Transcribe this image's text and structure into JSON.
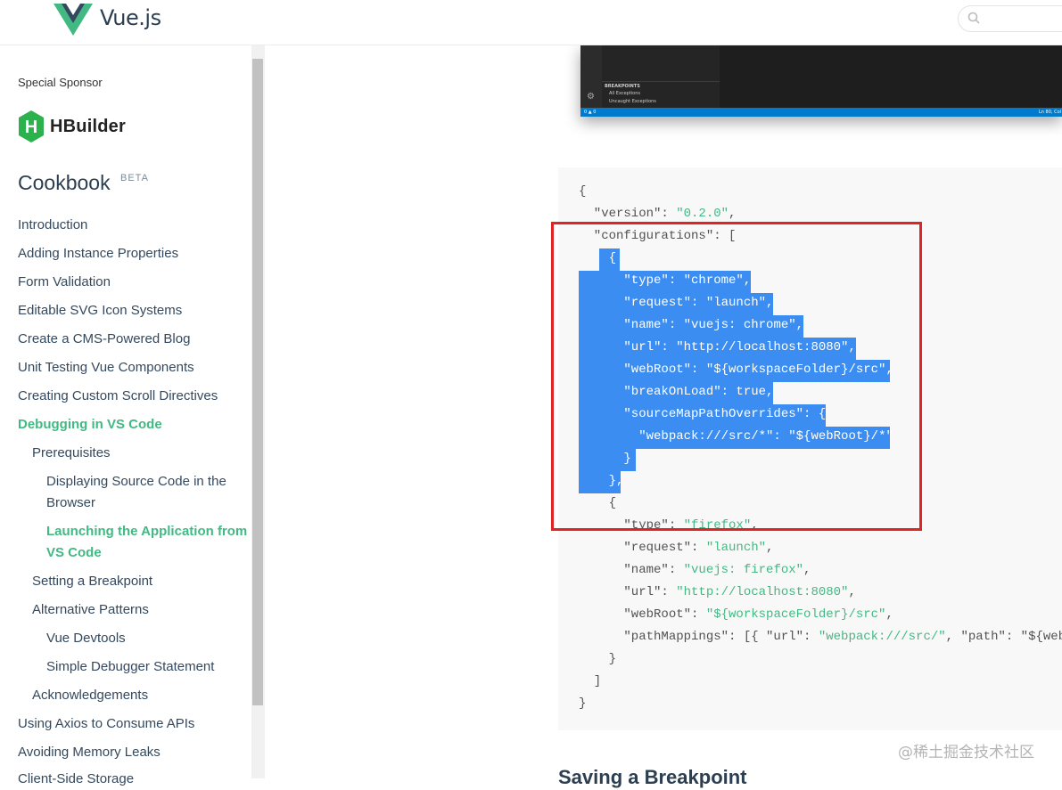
{
  "header": {
    "brand": "Vue.js",
    "search": {
      "placeholder": ""
    }
  },
  "sidebar": {
    "sponsor_label": "Special Sponsor",
    "sponsor_name": "HBuilder",
    "sponsor_logo_letter": "H",
    "title": "Cookbook",
    "badge": "BETA",
    "items": [
      {
        "label": "Introduction"
      },
      {
        "label": "Adding Instance Properties"
      },
      {
        "label": "Form Validation"
      },
      {
        "label": "Editable SVG Icon Systems"
      },
      {
        "label": "Create a CMS-Powered Blog"
      },
      {
        "label": "Unit Testing Vue Components"
      },
      {
        "label": "Creating Custom Scroll Directives"
      },
      {
        "label": "Debugging in VS Code"
      },
      {
        "label": "Prerequisites"
      },
      {
        "label": "Displaying Source Code in the"
      },
      {
        "label": "Browser"
      },
      {
        "label": "Launching the Application from"
      },
      {
        "label": "VS Code"
      },
      {
        "label": "Setting a Breakpoint"
      },
      {
        "label": "Alternative Patterns"
      },
      {
        "label": "Vue Devtools"
      },
      {
        "label": "Simple Debugger Statement"
      },
      {
        "label": "Acknowledgements"
      },
      {
        "label": "Using Axios to Consume APIs"
      },
      {
        "label": "Avoiding Memory Leaks"
      },
      {
        "label": "Client-Side Storage"
      }
    ]
  },
  "embedded_screenshot": {
    "breakpoints_label": "BREAKPOINTS",
    "all_exceptions": "All Exceptions",
    "uncaught_exceptions": "Uncaught Exceptions",
    "status_left": "0 ▲ 0",
    "status_right": "Ln 80, Col"
  },
  "code": {
    "lines": [
      {
        "pre": "{",
        "str": "",
        "post": ""
      },
      {
        "pre": "  \"version\": ",
        "str": "\"0.2.0\"",
        "post": ","
      },
      {
        "pre": "  \"configurations\": [",
        "str": "",
        "post": ""
      },
      {
        "pre": "    {",
        "str": "",
        "post": ""
      },
      {
        "pre": "      \"type\": ",
        "str": "\"chrome\"",
        "post": ","
      },
      {
        "pre": "      \"request\": ",
        "str": "\"launch\"",
        "post": ","
      },
      {
        "pre": "      \"name\": ",
        "str": "\"vuejs: chrome\"",
        "post": ","
      },
      {
        "pre": "      \"url\": ",
        "str": "\"http://localhost:8080\"",
        "post": ","
      },
      {
        "pre": "      \"webRoot\": ",
        "str": "\"${workspaceFolder}/src\"",
        "post": ","
      },
      {
        "pre": "      \"breakOnLoad\": true,",
        "str": "",
        "post": ""
      },
      {
        "pre": "      \"sourceMapPathOverrides\": {",
        "str": "",
        "post": ""
      },
      {
        "pre": "        \"webpack:///src/*\": ",
        "str": "\"${webRoot}/*\"",
        "post": ""
      },
      {
        "pre": "      }",
        "str": "",
        "post": ""
      },
      {
        "pre": "    },",
        "str": "",
        "post": ""
      },
      {
        "pre": "    {",
        "str": "",
        "post": ""
      },
      {
        "pre": "      \"type\": ",
        "str": "\"firefox\"",
        "post": ","
      },
      {
        "pre": "      \"request\": ",
        "str": "\"launch\"",
        "post": ","
      },
      {
        "pre": "      \"name\": ",
        "str": "\"vuejs: firefox\"",
        "post": ","
      },
      {
        "pre": "      \"url\": ",
        "str": "\"http://localhost:8080\"",
        "post": ","
      },
      {
        "pre": "      \"webRoot\": ",
        "str": "\"${workspaceFolder}/src\"",
        "post": ","
      },
      {
        "pre": "      \"pathMappings\": [{ \"url\": ",
        "str": "\"webpack:///src/\"",
        "post": ", \"path\": \"${webRo"
      },
      {
        "pre": "    }",
        "str": "",
        "post": ""
      },
      {
        "pre": "  ]",
        "str": "",
        "post": ""
      },
      {
        "pre": "}",
        "str": "",
        "post": ""
      }
    ]
  },
  "watermark": "@稀土掘金技术社区",
  "next_heading": "Saving a Breakpoint",
  "colors": {
    "accent": "#42b983",
    "selection": "#3b8df2",
    "annotation_box": "#e02424"
  }
}
